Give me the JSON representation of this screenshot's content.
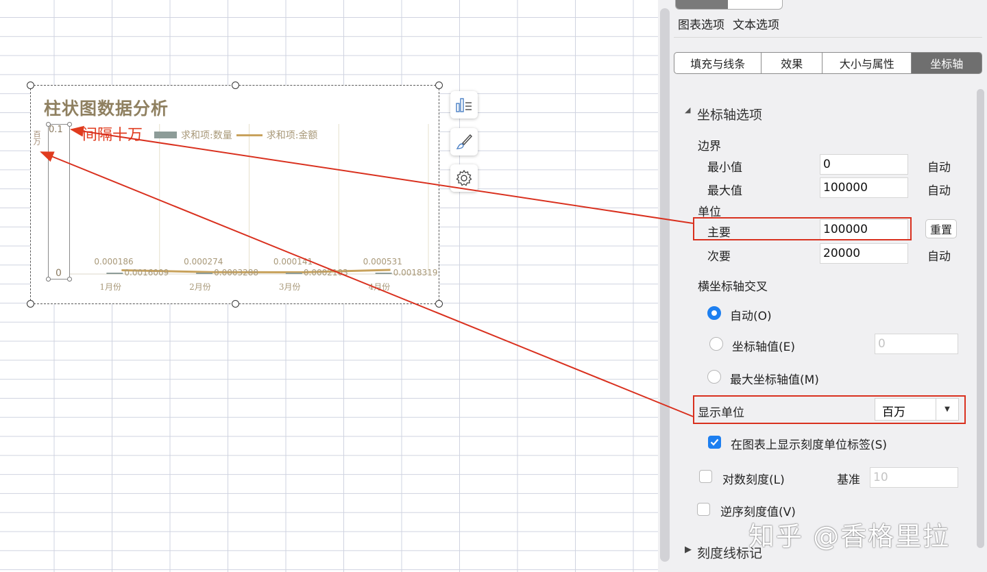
{
  "chart": {
    "title": "柱状图数据分析",
    "annotation": "间隔十万",
    "unit_label": "百万",
    "axis_max_label": "0.1",
    "axis_min_label": "0",
    "legend": [
      {
        "name": "求和项:数量",
        "color": "#8d9c98",
        "shape": "rect"
      },
      {
        "name": "求和项:金额",
        "color": "#c8a25c",
        "shape": "line"
      }
    ],
    "data_labels_qty": [
      "0.000186",
      "0.000274",
      "0.000141",
      "0.000531"
    ],
    "data_labels_amt": [
      "0.0016009",
      "0.0003288",
      "0.0002103",
      "0.0018319"
    ]
  },
  "chart_data": {
    "type": "bar",
    "title": "柱状图数据分析",
    "categories": [
      "1月份",
      "2月份",
      "3月份",
      "4月份"
    ],
    "series": [
      {
        "name": "求和项:数量",
        "values": [
          0.000186,
          0.000274,
          0.000141,
          0.000531
        ]
      },
      {
        "name": "求和项:金额",
        "values": [
          0.0016009,
          0.0003288,
          0.0002103,
          0.0018319
        ]
      }
    ],
    "ylim": [
      0,
      0.1
    ],
    "y_display_unit": "百万",
    "legend_position": "top",
    "grid": true
  },
  "chart_tools": [
    {
      "icon": "chart-elements-icon"
    },
    {
      "icon": "chart-style-brush-icon"
    },
    {
      "icon": "chart-settings-gear-icon"
    }
  ],
  "panel": {
    "top_options": [
      "图表选项",
      "文本选项"
    ],
    "tabs": [
      {
        "label": "填充与线条",
        "active": false
      },
      {
        "label": "效果",
        "active": false
      },
      {
        "label": "大小与属性",
        "active": false
      },
      {
        "label": "坐标轴",
        "active": true
      }
    ],
    "section_title": "坐标轴选项",
    "bounds_label": "边界",
    "min_label": "最小值",
    "min_value": "0",
    "min_auto": "自动",
    "max_label": "最大值",
    "max_value": "100000",
    "max_auto": "自动",
    "units_label": "单位",
    "major_label": "主要",
    "major_value": "100000",
    "reset_label": "重置",
    "minor_label": "次要",
    "minor_value": "20000",
    "minor_auto": "自动",
    "cross_label": "横坐标轴交叉",
    "cross_auto": "自动(O)",
    "cross_value_label": "坐标轴值(E)",
    "cross_value_placeholder": "0",
    "cross_max_label": "最大坐标轴值(M)",
    "display_unit_label": "显示单位",
    "display_unit_value": "百万",
    "show_unit_label_check": "在图表上显示刻度单位标签(S)",
    "log_scale_label": "对数刻度(L)",
    "base_label": "基准",
    "base_placeholder": "10",
    "reverse_label": "逆序刻度值(V)",
    "tick_marks_label": "刻度线标记"
  },
  "watermark": "知乎 @香格里拉",
  "accent_color": "#1d7ff0",
  "highlight_color": "#d9301e"
}
